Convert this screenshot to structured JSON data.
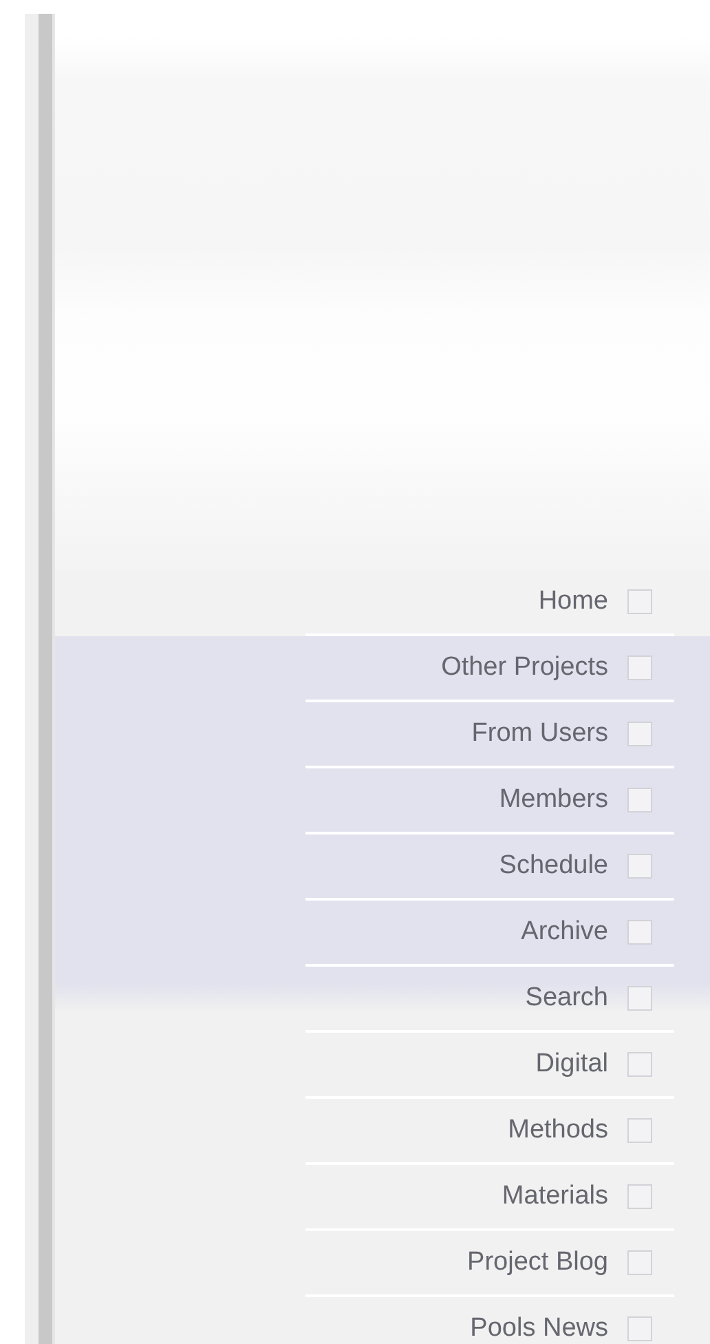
{
  "menu": [
    {
      "label": "Home"
    },
    {
      "label": "Other Projects"
    },
    {
      "label": "From Users"
    },
    {
      "label": "Members"
    },
    {
      "label": "Schedule"
    },
    {
      "label": "Archive"
    },
    {
      "label": "Search"
    },
    {
      "label": "Digital"
    },
    {
      "label": "Methods"
    },
    {
      "label": "Materials"
    },
    {
      "label": "Project Blog"
    },
    {
      "label": "Pools News"
    }
  ]
}
